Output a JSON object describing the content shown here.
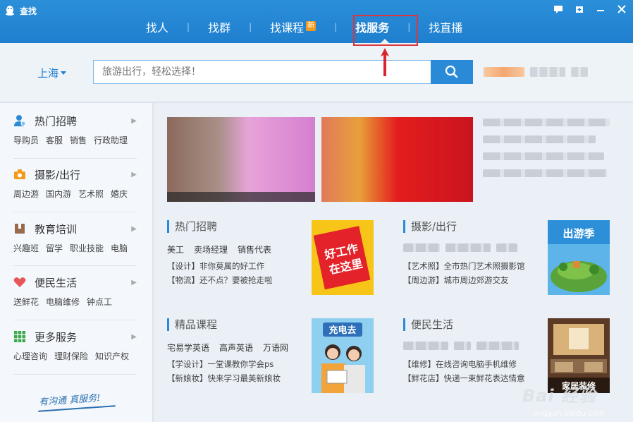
{
  "window": {
    "title": "查找",
    "buttons": [
      "feedback-icon",
      "pin-icon",
      "minimize-icon",
      "close-icon"
    ]
  },
  "nav": {
    "items": [
      {
        "label": "找人"
      },
      {
        "label": "找群"
      },
      {
        "label": "找课程",
        "badge": "新"
      },
      {
        "label": "找服务",
        "active": true
      },
      {
        "label": "找直播"
      }
    ]
  },
  "search": {
    "city": "上海",
    "placeholder": "旅游出行，轻松选择！"
  },
  "sidebar": {
    "categories": [
      {
        "title": "热门招聘",
        "icon": "recruit-user-icon",
        "subs": [
          "导购员",
          "客服",
          "销售",
          "行政助理"
        ]
      },
      {
        "title": "摄影/出行",
        "icon": "camera-icon",
        "subs": [
          "周边游",
          "国内游",
          "艺术照",
          "婚庆"
        ]
      },
      {
        "title": "教育培训",
        "icon": "book-icon",
        "subs": [
          "兴趣班",
          "留学",
          "职业技能",
          "电脑"
        ]
      },
      {
        "title": "便民生活",
        "icon": "heart-icon",
        "subs": [
          "送鲜花",
          "电脑维修",
          "钟点工"
        ]
      },
      {
        "title": "更多服务",
        "icon": "grid-icon",
        "subs": [
          "心理咨询",
          "理财保险",
          "知识产权"
        ]
      }
    ],
    "slogan": "有沟通 真服务!"
  },
  "cards": [
    {
      "title": "热门招聘",
      "tags": [
        "美工",
        "卖场经理",
        "销售代表"
      ],
      "lines": [
        "【设计】非你莫属的好工作",
        "【物流】还不点？要被抢走啦"
      ],
      "image_text": [
        "好工作",
        "在这里"
      ]
    },
    {
      "title": "摄影/出行",
      "tags": [],
      "lines": [
        "【艺术照】全市热门艺术照摄影馆",
        "【周边游】城市周边郊游交友"
      ],
      "image_text": [
        "出游季"
      ]
    },
    {
      "title": "精品课程",
      "tags": [
        "宅易学英语",
        "高声英语",
        "万语网"
      ],
      "lines": [
        "【学设计】一堂课教你学会ps",
        "【新娘妆】快来学习最美新娘妆"
      ],
      "image_text": [
        "充电去"
      ]
    },
    {
      "title": "便民生活",
      "tags": [],
      "lines": [
        "【维修】在线咨询电脑手机维修",
        "【鲜花店】快递一束鲜花表达情意"
      ],
      "image_text": [
        "家居装修"
      ]
    }
  ],
  "watermark": {
    "logo": "Bai 经验",
    "url": "jingyan.baidu.com"
  },
  "colors": {
    "titlebar": "#1f7fcf",
    "accent": "#2a8ad8",
    "highlight_box": "#d9363e"
  }
}
